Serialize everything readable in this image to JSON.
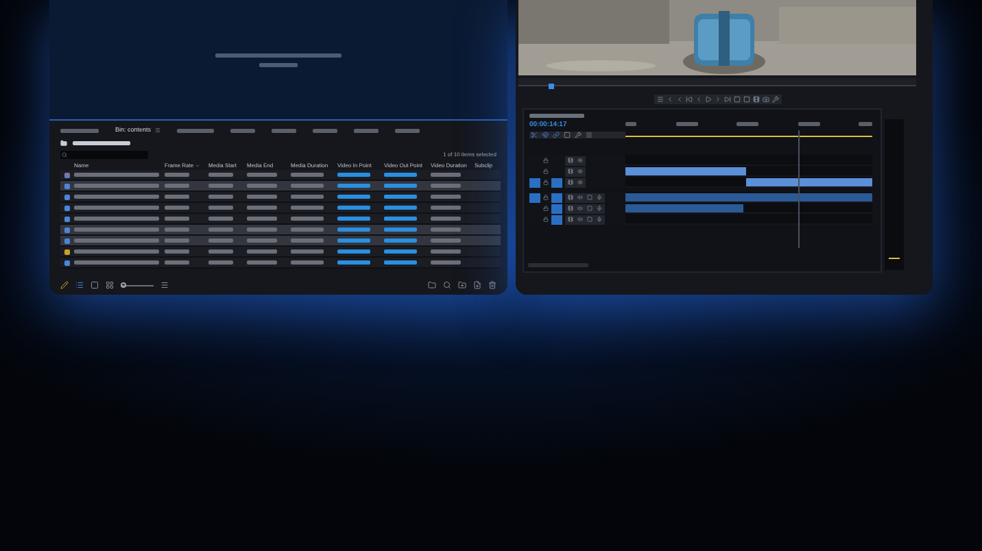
{
  "project_panel": {
    "bin_tab": {
      "label": "Bin: contents",
      "selected": true
    },
    "items_selected": "1 of 10 items selected",
    "columns": [
      {
        "label": "Name",
        "accent": false
      },
      {
        "label": "Frame Rate",
        "accent": false
      },
      {
        "label": "Media Start",
        "accent": false
      },
      {
        "label": "Media End",
        "accent": false
      },
      {
        "label": "Media Duration",
        "accent": false
      },
      {
        "label": "Video In Point",
        "accent": true
      },
      {
        "label": "Video Out Point",
        "accent": true
      },
      {
        "label": "Video Duration",
        "accent": false
      },
      {
        "label": "Subclip"
      }
    ],
    "zoom_slider": {
      "level": 0.08
    },
    "rows": [
      {
        "kind": "sequence",
        "color": "#d05a4a",
        "selected": false
      },
      {
        "kind": "clip",
        "color": "#4a86d8",
        "selected": true
      },
      {
        "kind": "clip",
        "color": "#4a86d8",
        "selected": false
      },
      {
        "kind": "clip",
        "color": "#4a86d8",
        "selected": false
      },
      {
        "kind": "clip",
        "color": "#4a86d8",
        "selected": false
      },
      {
        "kind": "clip",
        "color": "#4a86d8",
        "selected": true
      },
      {
        "kind": "clip",
        "color": "#4a86d8",
        "selected": true
      },
      {
        "kind": "clip",
        "color": "#c9a227",
        "selected": false
      },
      {
        "kind": "clip",
        "color": "#4a86d8",
        "selected": false
      }
    ]
  },
  "timeline": {
    "timecode": "00:00:14:17",
    "tracks": [
      {
        "kind": "video",
        "source_patch": false,
        "targeted": false
      },
      {
        "kind": "video",
        "source_patch": false,
        "targeted": false
      },
      {
        "kind": "video",
        "source_patch": true,
        "targeted": true
      },
      {
        "kind": "audio",
        "source_patch": true,
        "targeted": true
      },
      {
        "kind": "audio",
        "source_patch": false,
        "targeted": true
      },
      {
        "kind": "audio",
        "source_patch": false,
        "targeted": true
      }
    ]
  }
}
